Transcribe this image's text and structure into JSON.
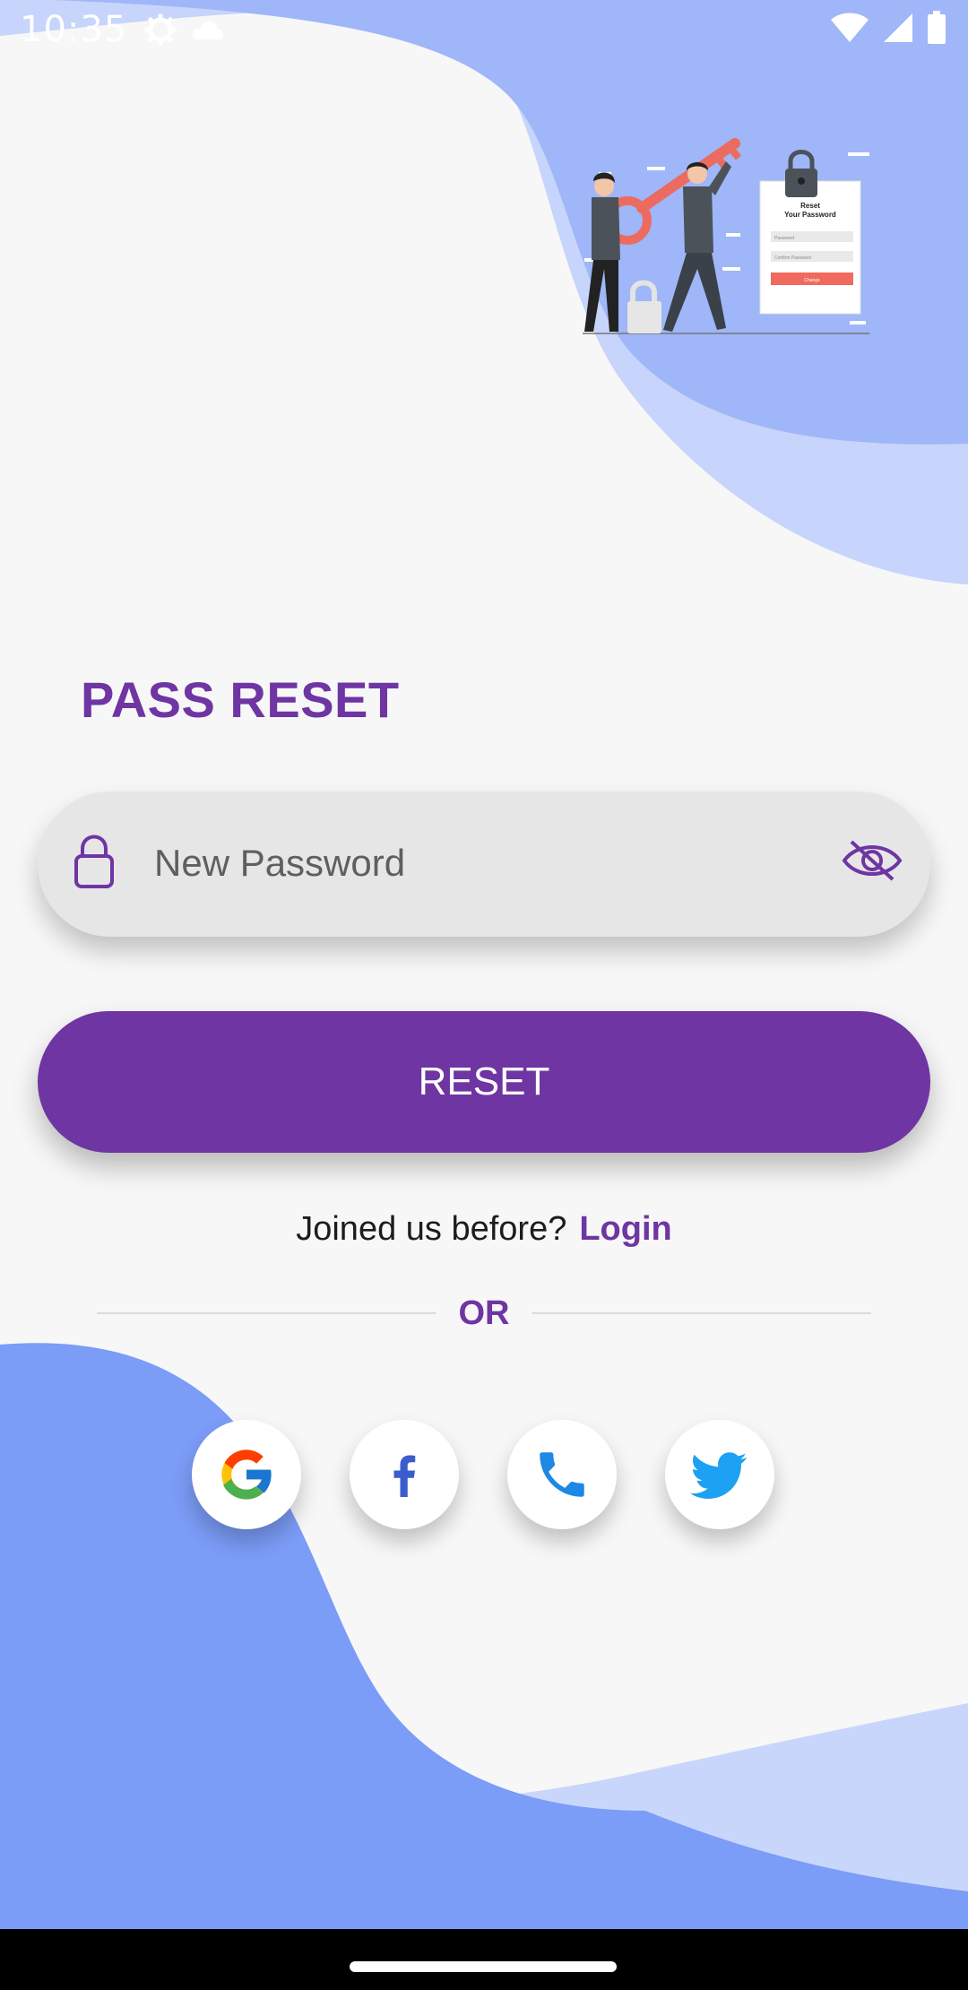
{
  "status_bar": {
    "time": "10:35",
    "left_icons": [
      "gear-icon",
      "cloud-icon"
    ],
    "right_icons": [
      "wifi-icon",
      "signal-icon",
      "battery-icon"
    ]
  },
  "hero": {
    "card_title_line1": "Reset",
    "card_title_line2": "Your Password",
    "card_field1": "Password",
    "card_field2": "Confirm Password",
    "card_button": "Change"
  },
  "title": "PASS RESET",
  "password_field": {
    "placeholder": "New Password",
    "value": "",
    "leading_icon": "lock-icon",
    "trailing_icon": "eye-off-icon"
  },
  "reset_button": {
    "label": "RESET"
  },
  "login_prompt": {
    "text": "Joined us before?",
    "link": "Login"
  },
  "divider": {
    "text": "OR"
  },
  "social": [
    {
      "name": "google",
      "icon": "google-icon"
    },
    {
      "name": "facebook",
      "icon": "facebook-icon"
    },
    {
      "name": "phone",
      "icon": "phone-icon"
    },
    {
      "name": "twitter",
      "icon": "twitter-icon"
    }
  ],
  "colors": {
    "accent": "#6e35a3",
    "wave_top": "#9fb6f8",
    "wave_top_light": "#c7d4fb",
    "wave_bottom": "#7b9cf7",
    "wave_bottom_light": "#c9d6fb",
    "field_bg": "#e6e6e6",
    "page_bg": "#f7f7f7"
  }
}
